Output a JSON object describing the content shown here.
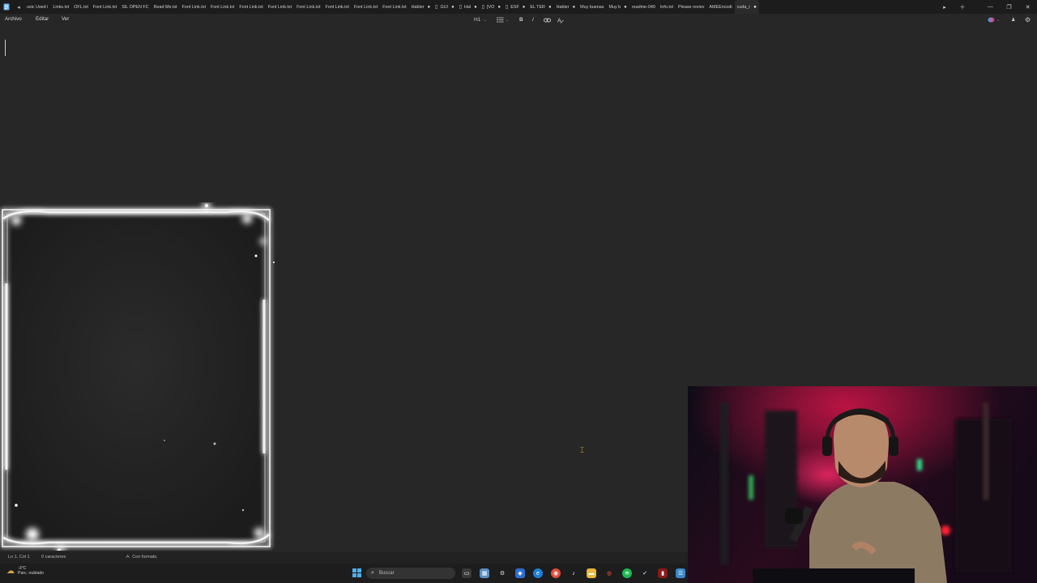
{
  "tabbar": {
    "tabs": [
      {
        "label": "usic Used i",
        "active": false
      },
      {
        "label": "Links.txt",
        "active": false
      },
      {
        "label": "OFL.txt",
        "active": false
      },
      {
        "label": "Font Link.txt",
        "active": false
      },
      {
        "label": "SIL OPEN FC",
        "active": false
      },
      {
        "label": "Read Me.txt",
        "active": false
      },
      {
        "label": "Font Link.txt",
        "active": false
      },
      {
        "label": "Font Link.txt",
        "active": false
      },
      {
        "label": "Font Link.txt",
        "active": false
      },
      {
        "label": "Font Link.txt",
        "active": false
      },
      {
        "label": "Font Link.txt",
        "active": false
      },
      {
        "label": "Font Link.txt",
        "active": false
      },
      {
        "label": "Font Link.txt",
        "active": false
      },
      {
        "label": "Font Link.txt",
        "active": false
      },
      {
        "label": "Habler",
        "active": false,
        "dot": true
      },
      {
        "label": "GUI",
        "active": false,
        "dot": true,
        "fav": true
      },
      {
        "label": "Hal",
        "active": false,
        "dot": true,
        "fav": true
      },
      {
        "label": "[VO",
        "active": false,
        "dot": true,
        "fav": true
      },
      {
        "label": "ESF",
        "active": false,
        "dot": true,
        "fav": true
      },
      {
        "label": "EL TER",
        "active": false,
        "dot": true
      },
      {
        "label": "Habler",
        "active": false,
        "dot": true
      },
      {
        "label": "Muy buenas",
        "active": false
      },
      {
        "label": "Muy b",
        "active": false,
        "dot": true
      },
      {
        "label": "readme-040",
        "active": false
      },
      {
        "label": "Info.txt",
        "active": false
      },
      {
        "label": "Please reviev",
        "active": false
      },
      {
        "label": "AMEEncodi",
        "active": false
      },
      {
        "label": "cuda_r",
        "active": true,
        "dot": true
      }
    ]
  },
  "menubar": {
    "file": "Archivo",
    "edit": "Editar",
    "view": "Ver",
    "heading": "H1"
  },
  "statusbar": {
    "position": "Ln 1, Col 1",
    "chars": "0 caracteres",
    "format": "Con formato"
  },
  "taskbar": {
    "weather_temp": "-3°C",
    "weather_desc": "Parc. nublado",
    "search_placeholder": "Buscar"
  },
  "colors": {
    "editor_bg": "#272727",
    "accent_blue": "#4fb0ec",
    "spotify": "#1db954"
  }
}
